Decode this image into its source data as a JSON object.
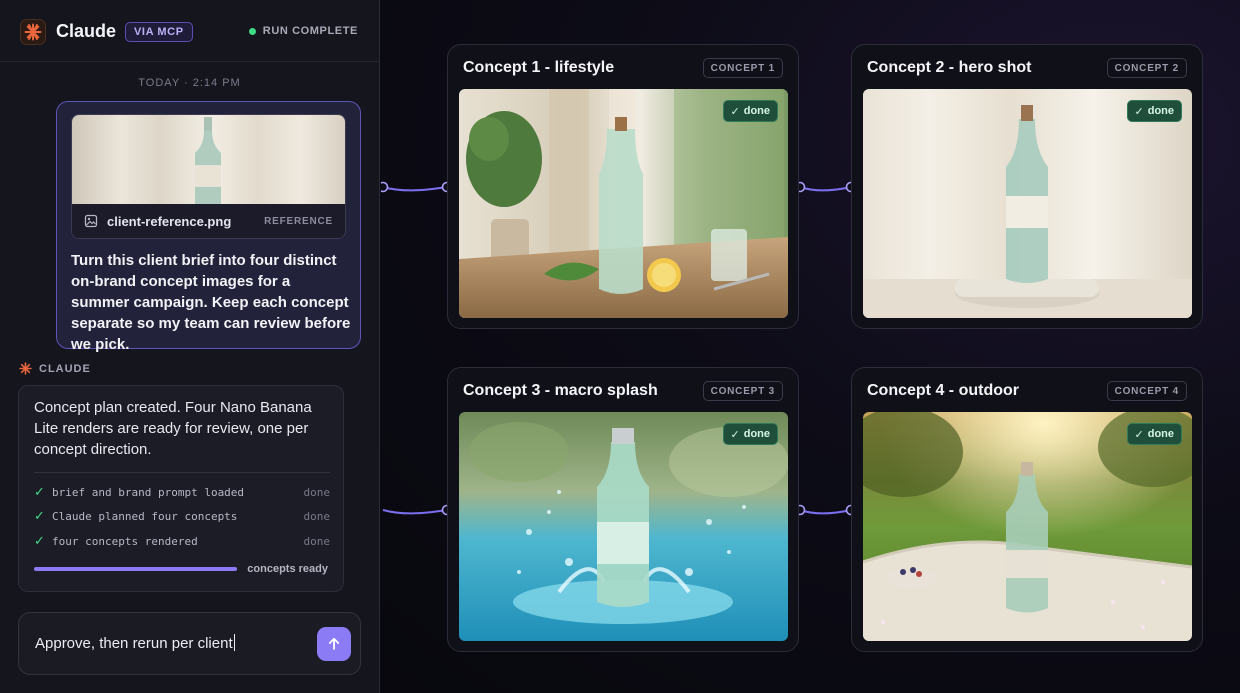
{
  "app": {
    "name": "Claude",
    "badge": "VIA MCP",
    "run_status": "RUN COMPLETE"
  },
  "chat": {
    "timestamp": "TODAY · 2:14 PM",
    "user_message": {
      "attachment": {
        "file_name": "client-reference.png",
        "label": "REFERENCE"
      },
      "text": "Turn this client brief into four distinct on-brand concept images for a summer campaign. Keep each concept separate so my team can review before we pick."
    },
    "assistant": {
      "label": "CLAUDE",
      "text": "Concept plan created. Four Nano Banana Lite renders are ready for review, one per concept direction.",
      "steps": [
        {
          "label": "brief and brand prompt loaded",
          "state": "done"
        },
        {
          "label": "Claude planned four concepts",
          "state": "done"
        },
        {
          "label": "four concepts rendered",
          "state": "done"
        }
      ],
      "progress": 1.0,
      "progress_label": "concepts ready"
    },
    "composer": {
      "value": "Approve, then rerun per client"
    }
  },
  "concepts": [
    {
      "title": "Concept 1 - lifestyle",
      "tag": "CONCEPT 1",
      "status": "done"
    },
    {
      "title": "Concept 2 - hero shot",
      "tag": "CONCEPT 2",
      "status": "done"
    },
    {
      "title": "Concept 3 - macro splash",
      "tag": "CONCEPT 3",
      "status": "done"
    },
    {
      "title": "Concept 4 - outdoor",
      "tag": "CONCEPT 4",
      "status": "done"
    }
  ],
  "icons": {
    "logo": "claude-sparkle-icon",
    "file": "image-file-icon",
    "check": "check-icon",
    "send": "arrow-up-icon"
  },
  "colors": {
    "accent": "#8b7cf6",
    "success": "#3ddc84",
    "brand_orange": "#e8663c"
  }
}
